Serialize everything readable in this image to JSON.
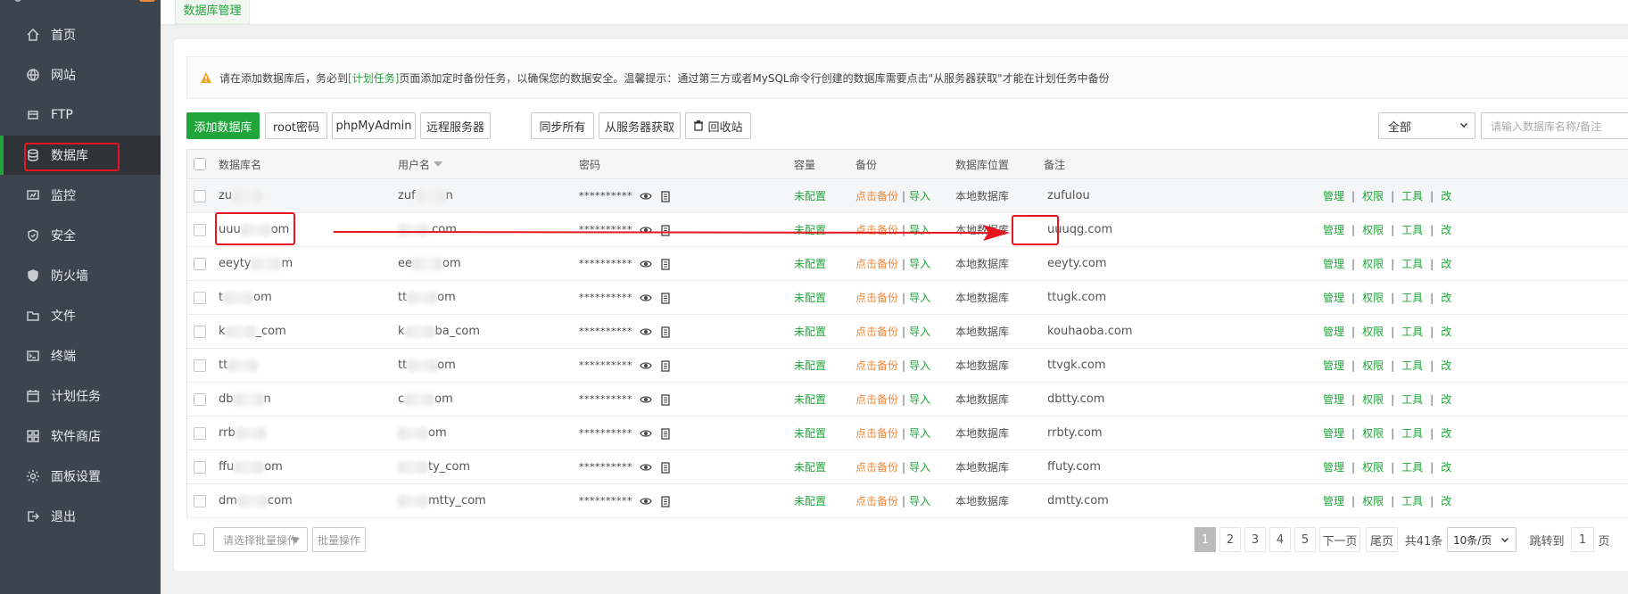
{
  "sidebar": {
    "items": [
      {
        "label": "首页",
        "icon": "home-icon"
      },
      {
        "label": "网站",
        "icon": "globe-icon"
      },
      {
        "label": "FTP",
        "icon": "ftp-icon"
      },
      {
        "label": "数据库",
        "icon": "database-icon",
        "active": true
      },
      {
        "label": "监控",
        "icon": "monitor-icon"
      },
      {
        "label": "安全",
        "icon": "shield-icon"
      },
      {
        "label": "防火墙",
        "icon": "firewall-icon"
      },
      {
        "label": "文件",
        "icon": "folder-icon"
      },
      {
        "label": "终端",
        "icon": "terminal-icon"
      },
      {
        "label": "计划任务",
        "icon": "calendar-icon"
      },
      {
        "label": "软件商店",
        "icon": "apps-icon"
      },
      {
        "label": "面板设置",
        "icon": "gear-icon"
      },
      {
        "label": "退出",
        "icon": "logout-icon"
      }
    ]
  },
  "tab": {
    "label": "数据库管理"
  },
  "notice": {
    "before": "请在添加数据库后，务必到",
    "link": "[计划任务]",
    "after": "页面添加定时备份任务，以确保您的数据安全。温馨提示：通过第三方或者MySQL命令行创建的数据库需要点击\"从服务器获取\"才能在计划任务中备份"
  },
  "toolbar": {
    "add_db": "添加数据库",
    "root_pw": "root密码",
    "phpmyadmin": "phpMyAdmin",
    "remote_server": "远程服务器",
    "sync_all": "同步所有",
    "fetch_server": "从服务器获取",
    "recycle": "回收站",
    "filter_value": "全部",
    "search_placeholder": "请输入数据库名称/备注"
  },
  "table": {
    "headers": {
      "name": "数据库名",
      "user": "用户名",
      "password": "密码",
      "capacity": "容量",
      "backup": "备份",
      "location": "数据库位置",
      "note": "备注"
    },
    "rows": [
      {
        "name": "zu",
        "user": "zuf",
        "user_tail": "n",
        "pw": "**********",
        "capacity": "未配置",
        "backup": "点击备份",
        "import": "导入",
        "location": "本地数据库",
        "note": "zufulou"
      },
      {
        "name": "uuu",
        "name_tail": "om",
        "user": "",
        "user_tail": ".com",
        "pw": "**********",
        "capacity": "未配置",
        "backup": "点击备份",
        "import": "导入",
        "location": "本地数据库",
        "note": "uuuqg.com"
      },
      {
        "name": "eeyty",
        "name_tail": "m",
        "user": "ee",
        "user_tail": "om",
        "pw": "**********",
        "capacity": "未配置",
        "backup": "点击备份",
        "import": "导入",
        "location": "本地数据库",
        "note": "eeyty.com"
      },
      {
        "name": "t",
        "name_tail": "om",
        "user": "tt",
        "user_tail": "om",
        "pw": "**********",
        "capacity": "未配置",
        "backup": "点击备份",
        "import": "导入",
        "location": "本地数据库",
        "note": "ttugk.com"
      },
      {
        "name": "k",
        "name_tail": "_com",
        "user": "k",
        "user_tail": "ba_com",
        "pw": "**********",
        "capacity": "未配置",
        "backup": "点击备份",
        "import": "导入",
        "location": "本地数据库",
        "note": "kouhaoba.com"
      },
      {
        "name": "tt",
        "name_tail": "",
        "user": "tt",
        "user_tail": "om",
        "pw": "**********",
        "capacity": "未配置",
        "backup": "点击备份",
        "import": "导入",
        "location": "本地数据库",
        "note": "ttvgk.com"
      },
      {
        "name": "db",
        "name_tail": "n",
        "user": "c",
        "user_tail": "om",
        "pw": "**********",
        "capacity": "未配置",
        "backup": "点击备份",
        "import": "导入",
        "location": "本地数据库",
        "note": "dbtty.com"
      },
      {
        "name": "rrb",
        "name_tail": "",
        "user": "",
        "user_tail": "om",
        "pw": "**********",
        "capacity": "未配置",
        "backup": "点击备份",
        "import": "导入",
        "location": "本地数据库",
        "note": "rrbty.com"
      },
      {
        "name": "ffu",
        "name_tail": "om",
        "user": "",
        "user_tail": "ty_com",
        "pw": "**********",
        "capacity": "未配置",
        "backup": "点击备份",
        "import": "导入",
        "location": "本地数据库",
        "note": "ffuty.com"
      },
      {
        "name": "dm",
        "name_tail": "com",
        "user": "",
        "user_tail": "mtty_com",
        "pw": "**********",
        "capacity": "未配置",
        "backup": "点击备份",
        "import": "导入",
        "location": "本地数据库",
        "note": "dmtty.com"
      }
    ],
    "ops": {
      "manage": "管理",
      "perm": "权限",
      "tools": "工具",
      "edit": "改"
    }
  },
  "footer": {
    "batch_placeholder": "请选择批量操作",
    "batch_btn": "批量操作",
    "pages": [
      "1",
      "2",
      "3",
      "4",
      "5"
    ],
    "next": "下一页",
    "last": "尾页",
    "total": "共41条",
    "per_page": "10条/页",
    "goto": "跳转到",
    "goto_value": "1",
    "page_partial": "页"
  },
  "colors": {
    "accent": "#20a53a",
    "sidebar_bg": "#3c444d",
    "annotation": "#e5161f",
    "backup_link": "#f0883a"
  }
}
